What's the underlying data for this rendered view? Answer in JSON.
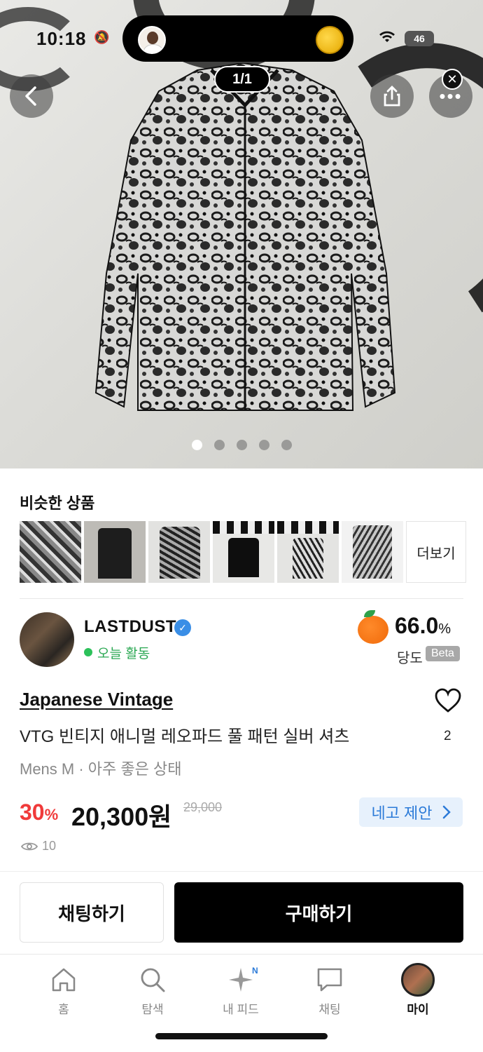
{
  "status_bar": {
    "time": "10:18",
    "battery": "46"
  },
  "hero": {
    "pager": "1/1",
    "dot_count": 5,
    "active_dot": 0
  },
  "similar": {
    "title": "비슷한 상품",
    "more_label": "더보기"
  },
  "seller": {
    "name": "LASTDUST",
    "activity": "오늘 활동",
    "score": "66.0",
    "score_unit": "%",
    "score_label": "당도",
    "beta": "Beta"
  },
  "product": {
    "brand": "Japanese Vintage",
    "title": "VTG 빈티지 애니멀 레오파드 풀 패턴 실버 셔츠",
    "condition": "Mens M · 아주 좋은 상태",
    "discount": "30",
    "discount_unit": "%",
    "price": "20,300원",
    "original_price": "29,000",
    "offer_label": "네고 제안",
    "views": "10",
    "likes": "2"
  },
  "actions": {
    "chat": "채팅하기",
    "buy": "구매하기"
  },
  "tabbar": {
    "items": [
      {
        "label": "홈",
        "icon": "home-icon"
      },
      {
        "label": "탐색",
        "icon": "search-icon"
      },
      {
        "label": "내 피드",
        "icon": "sparkle-icon",
        "badge": "N"
      },
      {
        "label": "채팅",
        "icon": "chat-bubble-icon"
      },
      {
        "label": "마이",
        "icon": "avatar"
      }
    ]
  },
  "colors": {
    "discount": "#f03a3a",
    "accent_blue": "#2b7ad8",
    "active_green": "#2ba853",
    "buy_button": "#000000"
  }
}
